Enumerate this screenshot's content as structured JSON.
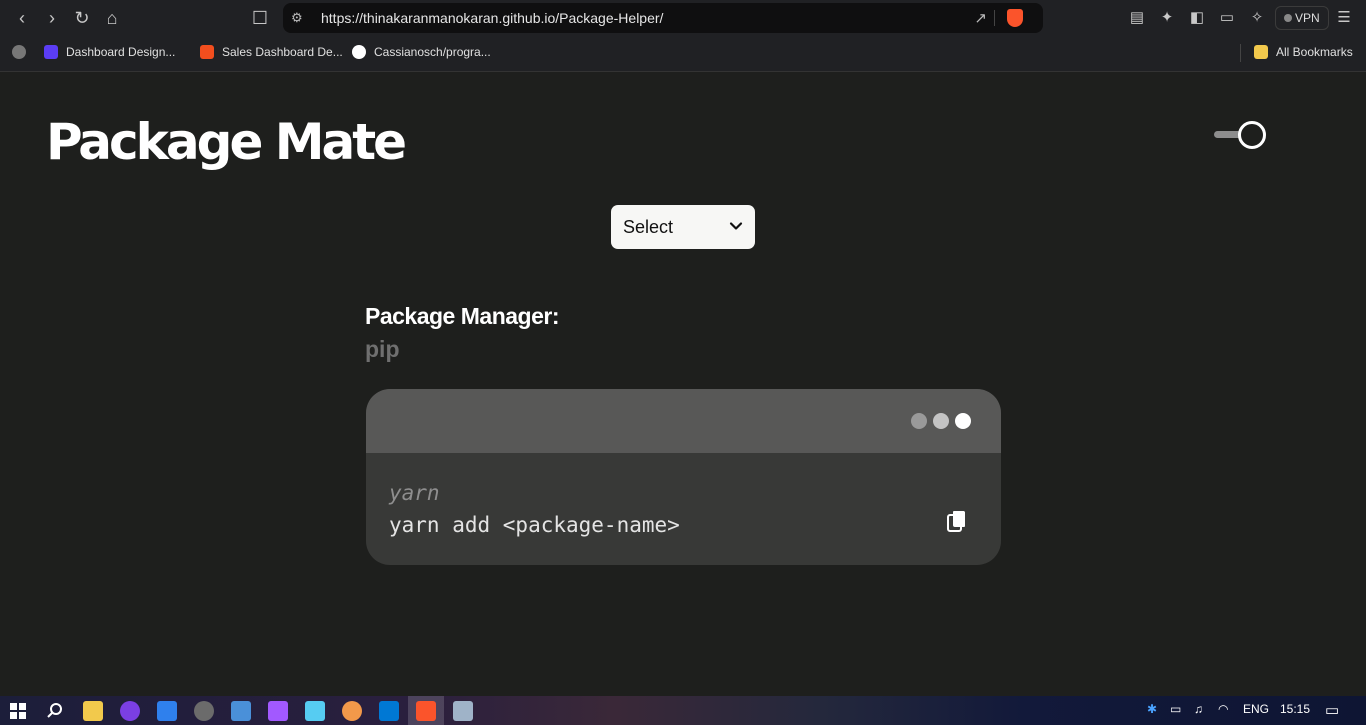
{
  "browser": {
    "url": "https://thinakaranmanokaran.github.io/Package-Helper/",
    "vpn_label": "VPN",
    "bookmarks": [
      {
        "label": "Dashboard Design...",
        "color": "#5b3df5"
      },
      {
        "label": "Sales Dashboard De...",
        "color": "#f24e1e"
      },
      {
        "label": "Cassianosch/progra...",
        "color": "#ffffff"
      }
    ],
    "all_bookmarks_label": "All Bookmarks"
  },
  "page": {
    "title": "Package Mate",
    "select": {
      "value": "Select"
    },
    "package_manager_label": "Package Manager:",
    "package_manager_value": "pip",
    "terminal": {
      "comment": "yarn",
      "command": "yarn add <package-name>"
    }
  },
  "taskbar": {
    "language": "ENG",
    "time": "15:15"
  },
  "colors": {
    "background": "#1e1f1d",
    "terminal_bg": "#383937",
    "terminal_bar": "#585857",
    "accent_brave": "#fb542b"
  }
}
